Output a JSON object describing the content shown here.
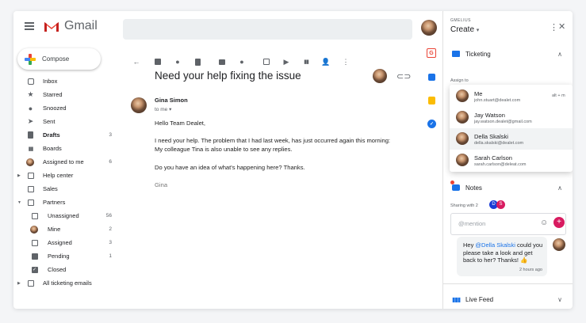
{
  "app": {
    "name": "Gmail"
  },
  "compose": {
    "label": "Compose"
  },
  "nav": {
    "inbox": "Inbox",
    "starred": "Starred",
    "snoozed": "Snoozed",
    "sent": "Sent",
    "drafts": {
      "label": "Drafts",
      "count": "3"
    },
    "boards": "Boards",
    "assigned_to_me": {
      "label": "Assigned to me",
      "count": "6"
    },
    "help_center": "Help center",
    "sales": "Sales",
    "partners": "Partners",
    "unassigned": {
      "label": "Unassigned",
      "count": "56"
    },
    "mine": {
      "label": "Mine",
      "count": "2"
    },
    "assigned": {
      "label": "Assigned",
      "count": "3"
    },
    "pending": {
      "label": "Pending",
      "count": "1"
    },
    "closed": "Closed",
    "all_ticketing": "All ticketing emails"
  },
  "email": {
    "subject": "Need your help fixing the issue",
    "sender": "Gina Simon",
    "to": "to me",
    "greeting": "Hello Team Dealet,",
    "line1": "I need your help. The problem that I had last week, has just occurred again this morning:",
    "line2": "My colleague Tina is also unable to see any replies.",
    "line3": "Do you have an idea of what's happening here? Thanks.",
    "signature": "Gina"
  },
  "panel": {
    "brand": "GMELIUS",
    "create": "Create",
    "ticketing": "Ticketing",
    "assign_to": "Assign to",
    "assignees": [
      {
        "name": "Me",
        "email": "john.stuart@dealet.com",
        "shortcut": "alt + m"
      },
      {
        "name": "Jay Watson",
        "email": "jay.watson.dealet@gmail.com"
      },
      {
        "name": "Della Skalski",
        "email": "della.skalski@dealet.com"
      },
      {
        "name": "Sarah Carlson",
        "email": "sarah.carlson@deleat.com"
      }
    ],
    "notes": "Notes",
    "sharing_with": "Sharing with 2",
    "sharing_badges": [
      "D",
      "S"
    ],
    "mention_placeholder": "@mention",
    "comment": {
      "mention": "@Della Skalski",
      "text_before": "Hey ",
      "text_after": " could you please take a look and get back to her? Thanks! 👍",
      "time": "2 hours ago"
    },
    "live_feed": "Live Feed"
  },
  "colors": {
    "gmail_red": "#ea4335",
    "accent_pink": "#d81b60",
    "badge_blue": "#1a3cd6",
    "mention_blue": "#1a73e8"
  }
}
